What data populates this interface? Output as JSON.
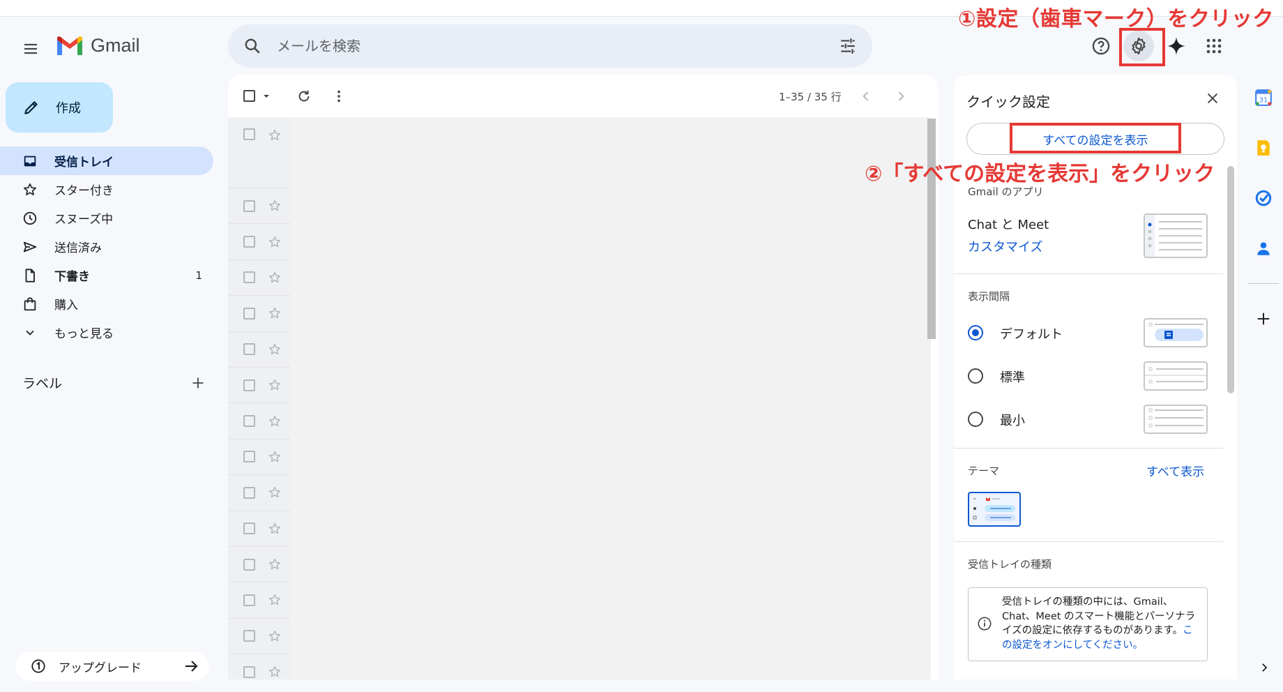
{
  "app": {
    "name": "Gmail"
  },
  "search": {
    "placeholder": "メールを検索"
  },
  "annotations": {
    "step1": "①設定（歯車マーク）をクリック",
    "step2": "②「すべての設定を表示」をクリック"
  },
  "compose": {
    "label": "作成"
  },
  "sidebar": {
    "items": [
      {
        "label": "受信トレイ",
        "icon": "inbox-icon",
        "count": ""
      },
      {
        "label": "スター付き",
        "icon": "star-icon",
        "count": ""
      },
      {
        "label": "スヌーズ中",
        "icon": "clock-icon",
        "count": ""
      },
      {
        "label": "送信済み",
        "icon": "send-icon",
        "count": ""
      },
      {
        "label": "下書き",
        "icon": "draft-icon",
        "count": "1"
      },
      {
        "label": "購入",
        "icon": "shopping-bag-icon",
        "count": ""
      },
      {
        "label": "もっと見る",
        "icon": "chevron-down-icon",
        "count": ""
      }
    ],
    "labels_heading": "ラベル",
    "upgrade_label": "アップグレード"
  },
  "list": {
    "pager": "1–35 / 35 行"
  },
  "quick_settings": {
    "title": "クイック設定",
    "all_settings_button": "すべての設定を表示",
    "apps_heading": "Gmail のアプリ",
    "apps_name": "Chat と Meet",
    "customize_link": "カスタマイズ",
    "density_heading": "表示間隔",
    "density_options": [
      "デフォルト",
      "標準",
      "最小"
    ],
    "theme_heading": "テーマ",
    "theme_show_all": "すべて表示",
    "inbox_type_heading": "受信トレイの種類",
    "inbox_type_info": "受信トレイの種類の中には、Gmail、Chat、Meet のスマート機能とパーソナライズの設定に依存するものがあります。",
    "inbox_type_link": "この設定をオンにしてください。"
  },
  "colors": {
    "accent": "#0b57d0",
    "annotation_red": "#e53935",
    "compose_bg": "#c2e7ff",
    "active_nav_bg": "#d3e3fd"
  }
}
